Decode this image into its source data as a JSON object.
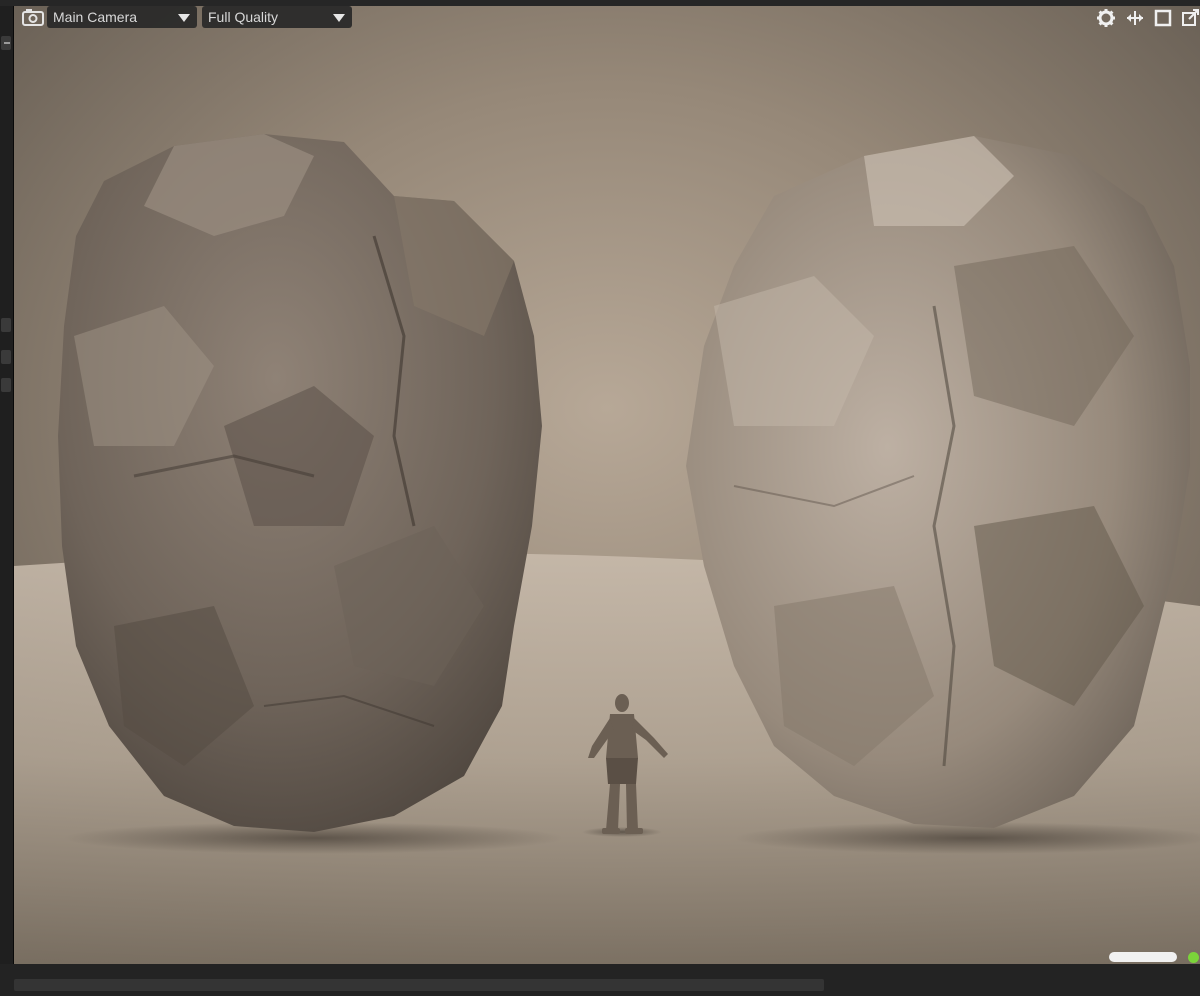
{
  "toolbar": {
    "camera_select": "Main Camera",
    "quality_select": "Full Quality",
    "icons": [
      "camera-icon",
      "gear-icon",
      "move-arrows-icon",
      "maximize-icon",
      "popout-icon"
    ]
  },
  "scene": {
    "background": "#8a7e72",
    "subjects": [
      "left-boulder",
      "armored-character",
      "right-boulder"
    ]
  },
  "status": {
    "indicator_color": "#7bd43a",
    "progress_color": "#f1f1f1"
  }
}
